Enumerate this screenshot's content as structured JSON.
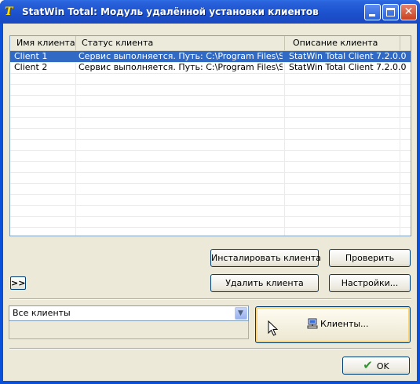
{
  "window": {
    "title": "StatWin Total: Модуль удалённой установки клиентов",
    "app_icon_text": "T",
    "controls": {
      "minimize": "minimize",
      "maximize": "maximize",
      "close": "close"
    }
  },
  "clients_table": {
    "columns": [
      "Имя клиента",
      "Статус клиента",
      "Описание клиента"
    ],
    "rows": [
      {
        "name": "Client 1",
        "status": "Сервис выполняется. Путь: C:\\Program Files\\SX...",
        "description": "StatWin Total Client 7.2.0.0",
        "selected": true
      },
      {
        "name": "Client 2",
        "status": "Сервис выполняется. Путь: C:\\Program Files\\SX...",
        "description": "StatWin Total Client 7.2.0.0",
        "selected": false
      }
    ]
  },
  "actions": {
    "install_label": "Инсталировать клиента",
    "check_label": "Проверить",
    "delete_label": "Удалить клиента",
    "settings_label": "Настройки...",
    "expand_label": ">>"
  },
  "filter": {
    "selected": "Все клиенты"
  },
  "clients_button": {
    "label": "Клиенты...",
    "icon": "computer-icon"
  },
  "footer": {
    "ok_label": "OK",
    "ok_icon": "checkmark-icon"
  },
  "colors": {
    "titlebar": "#1f55d1",
    "selection": "#316ac5",
    "dialog_bg": "#ece9d8"
  }
}
